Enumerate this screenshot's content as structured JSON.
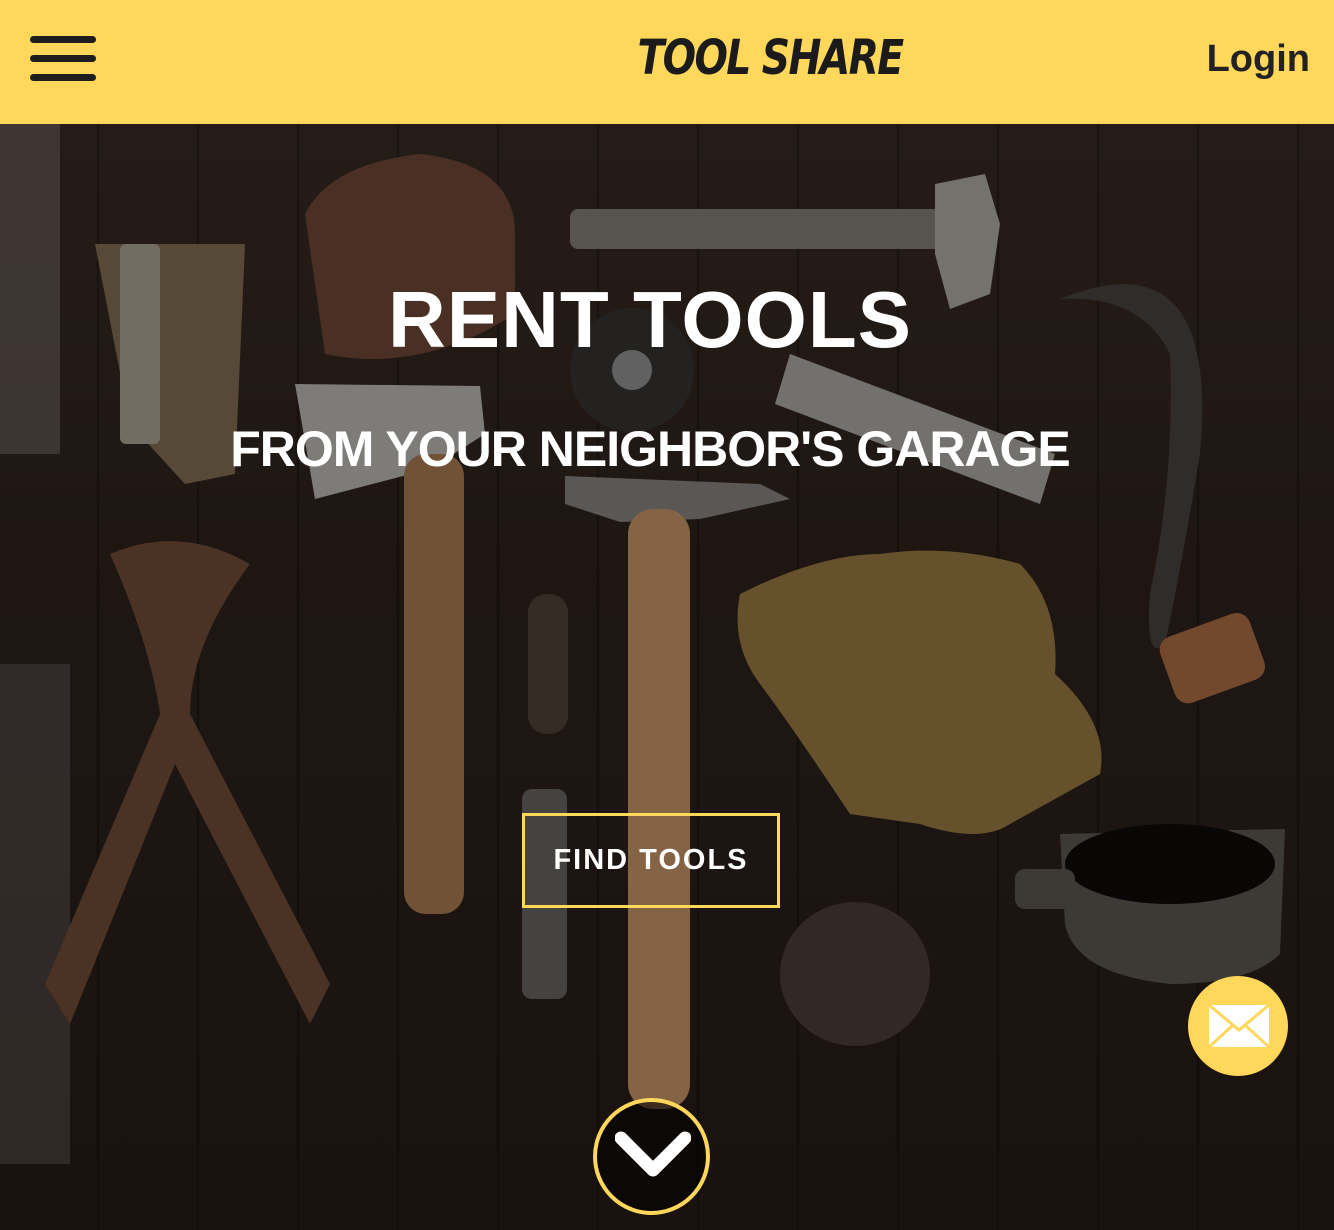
{
  "header": {
    "logo": "TOOL SHARE",
    "login_label": "Login",
    "menu_icon": "hamburger-menu-icon"
  },
  "hero": {
    "title": "RENT TOOLS",
    "subtitle": "FROM YOUR NEIGHBOR'S GARAGE",
    "cta_label": "FIND TOOLS",
    "scroll_icon": "chevron-down-icon"
  },
  "contact": {
    "icon": "envelope-icon"
  },
  "colors": {
    "accent": "#ffd75a",
    "text_light": "#ffffff",
    "text_dark": "#1d1d1d"
  }
}
